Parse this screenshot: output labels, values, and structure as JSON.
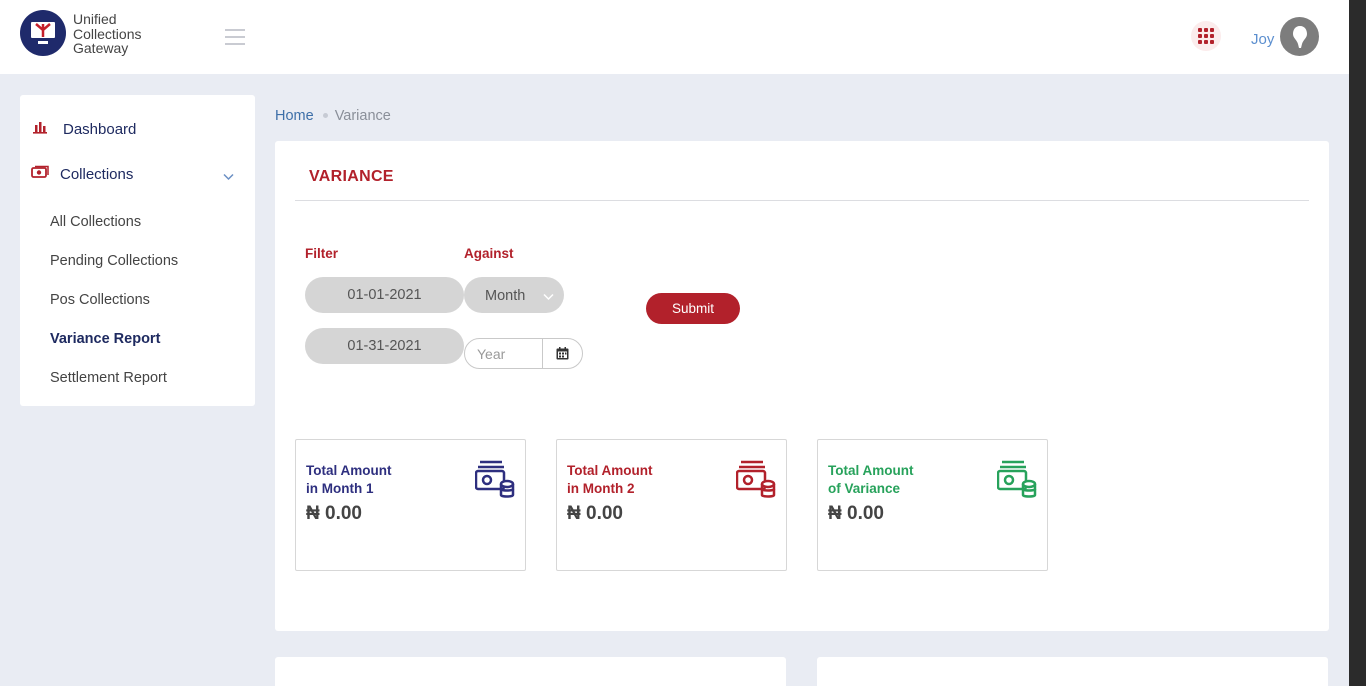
{
  "header": {
    "logo_icon": "tv-monitor-icon",
    "logo_lines": [
      "Unified",
      "Collections",
      "Gateway"
    ],
    "user_name": "Joy",
    "apps_icon": "grid-apps-icon",
    "avatar_icon": "user-avatar-icon"
  },
  "sidebar": {
    "dashboard": {
      "label": "Dashboard",
      "icon": "bar-chart-icon"
    },
    "collections": {
      "label": "Collections",
      "icon": "money-icon",
      "expanded": true
    },
    "sub_items": [
      {
        "label": "All Collections",
        "active": false
      },
      {
        "label": "Pending Collections",
        "active": false
      },
      {
        "label": "Pos Collections",
        "active": false
      },
      {
        "label": "Variance Report",
        "active": true
      },
      {
        "label": "Settlement Report",
        "active": false
      }
    ]
  },
  "breadcrumb": {
    "home": "Home",
    "current": "Variance"
  },
  "page": {
    "title": "VARIANCE",
    "filter_label": "Filter",
    "against_label": "Against",
    "date_from": "01-01-2021",
    "date_to": "01-31-2021",
    "against_select": "Month",
    "year_placeholder": "Year",
    "submit_label": "Submit"
  },
  "stats": [
    {
      "line1": "Total Amount",
      "line2": "in Month 1",
      "amount": "₦ 0.00",
      "color": "#2e2f7f",
      "icon": "cash-coins-icon"
    },
    {
      "line1": "Total Amount",
      "line2": "in Month 2",
      "amount": "₦ 0.00",
      "color": "#b2212b",
      "icon": "cash-coins-icon"
    },
    {
      "line1": "Total Amount",
      "line2": "of Variance",
      "amount": "₦ 0.00",
      "color": "#27a25b",
      "icon": "cash-coins-icon"
    }
  ],
  "colors": {
    "brand_red": "#b2212b",
    "navy": "#1e2a60",
    "link_blue": "#3d6fa8"
  }
}
